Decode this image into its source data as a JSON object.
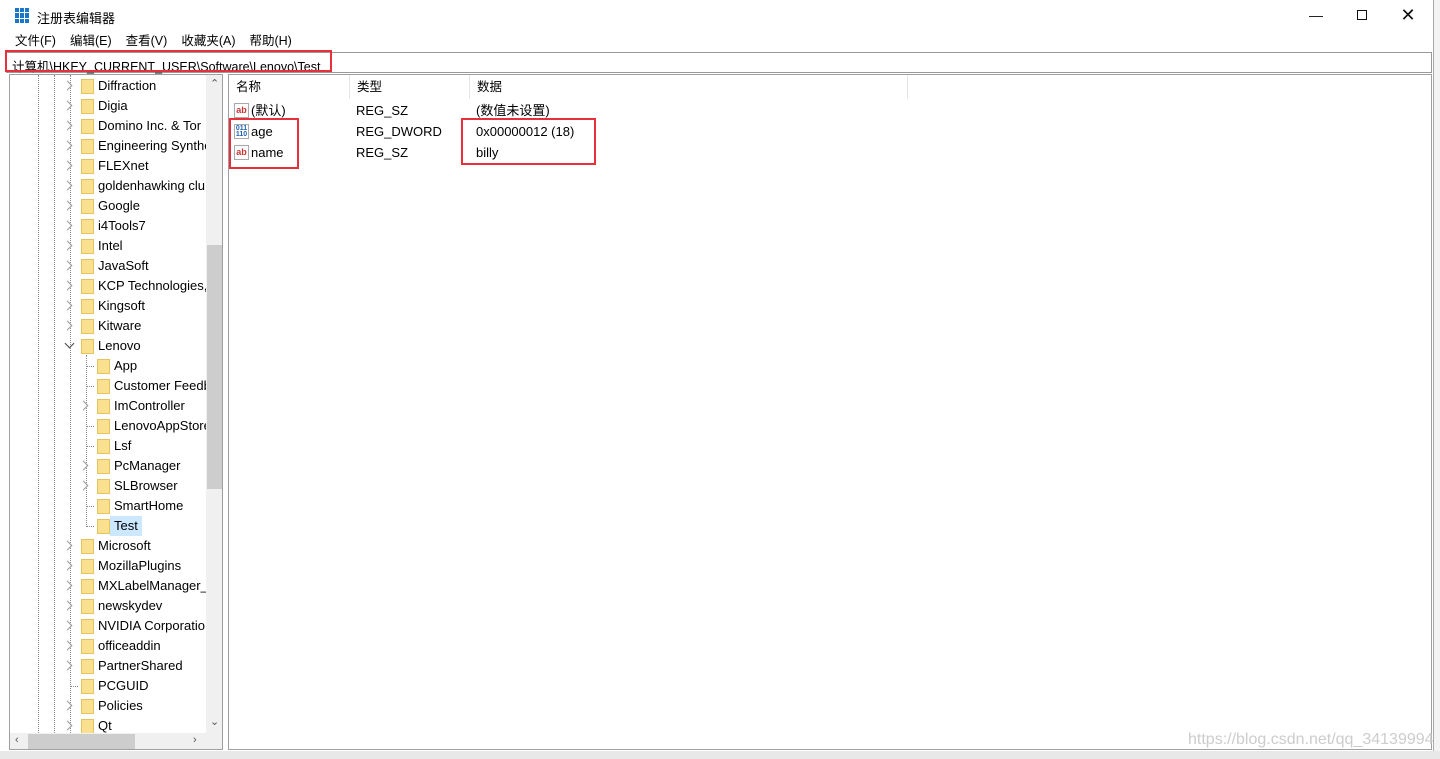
{
  "window": {
    "title": "注册表编辑器",
    "app_icon": "registry-editor-icon",
    "minimize_icon": "minimize-icon",
    "maximize_icon": "maximize-icon",
    "close_icon": "close-icon"
  },
  "menu": [
    "文件(F)",
    "编辑(E)",
    "查看(V)",
    "收藏夹(A)",
    "帮助(H)"
  ],
  "address": "计算机\\HKEY_CURRENT_USER\\Software\\Lenovo\\Test",
  "highlight_color": "#e8303a",
  "tree": [
    {
      "label": "Diffraction",
      "level": 1,
      "expandable": true
    },
    {
      "label": "Digia",
      "level": 1,
      "expandable": true
    },
    {
      "label": "Domino Inc. & Tor",
      "level": 1,
      "expandable": true
    },
    {
      "label": "Engineering Synthe",
      "level": 1,
      "expandable": true
    },
    {
      "label": "FLEXnet",
      "level": 1,
      "expandable": true
    },
    {
      "label": "goldenhawking clu",
      "level": 1,
      "expandable": true
    },
    {
      "label": "Google",
      "level": 1,
      "expandable": true
    },
    {
      "label": "i4Tools7",
      "level": 1,
      "expandable": true
    },
    {
      "label": "Intel",
      "level": 1,
      "expandable": true
    },
    {
      "label": "JavaSoft",
      "level": 1,
      "expandable": true
    },
    {
      "label": "KCP Technologies,",
      "level": 1,
      "expandable": true
    },
    {
      "label": "Kingsoft",
      "level": 1,
      "expandable": true
    },
    {
      "label": "Kitware",
      "level": 1,
      "expandable": true
    },
    {
      "label": "Lenovo",
      "level": 1,
      "expandable": true,
      "expanded": true
    },
    {
      "label": "App",
      "level": 2,
      "expandable": false
    },
    {
      "label": "Customer Feedb",
      "level": 2,
      "expandable": false
    },
    {
      "label": "ImController",
      "level": 2,
      "expandable": true
    },
    {
      "label": "LenovoAppStore",
      "level": 2,
      "expandable": false
    },
    {
      "label": "Lsf",
      "level": 2,
      "expandable": false
    },
    {
      "label": "PcManager",
      "level": 2,
      "expandable": true
    },
    {
      "label": "SLBrowser",
      "level": 2,
      "expandable": true
    },
    {
      "label": "SmartHome",
      "level": 2,
      "expandable": false
    },
    {
      "label": "Test",
      "level": 2,
      "expandable": false,
      "selected": true
    },
    {
      "label": "Microsoft",
      "level": 1,
      "expandable": true
    },
    {
      "label": "MozillaPlugins",
      "level": 1,
      "expandable": true
    },
    {
      "label": "MXLabelManager_",
      "level": 1,
      "expandable": true
    },
    {
      "label": "newskydev",
      "level": 1,
      "expandable": true
    },
    {
      "label": "NVIDIA Corporatio",
      "level": 1,
      "expandable": true
    },
    {
      "label": "officeaddin",
      "level": 1,
      "expandable": true
    },
    {
      "label": "PartnerShared",
      "level": 1,
      "expandable": true
    },
    {
      "label": "PCGUID",
      "level": 1,
      "expandable": false
    },
    {
      "label": "Policies",
      "level": 1,
      "expandable": true
    },
    {
      "label": "Qt",
      "level": 1,
      "expandable": true
    }
  ],
  "list": {
    "columns": [
      "名称",
      "类型",
      "数据"
    ],
    "rows": [
      {
        "name": "(默认)",
        "type": "REG_SZ",
        "data": "(数值未设置)",
        "icon": "string-value-icon"
      },
      {
        "name": "age",
        "type": "REG_DWORD",
        "data": "0x00000012 (18)",
        "icon": "binary-value-icon"
      },
      {
        "name": "name",
        "type": "REG_SZ",
        "data": "billy",
        "icon": "string-value-icon"
      }
    ]
  },
  "watermark": "https://blog.csdn.net/qq_34139994"
}
